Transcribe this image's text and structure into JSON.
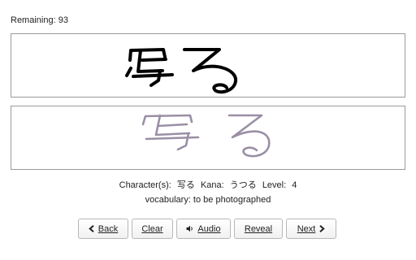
{
  "status": {
    "remaining": "Remaining: 93"
  },
  "character_info": {
    "chars_label": "Character(s):",
    "chars_value": "写る",
    "kana_label": "Kana:",
    "kana_value": "うつる",
    "level_label": "Level:",
    "level_value": "4"
  },
  "vocabulary": {
    "text": "vocabulary: to be photographed"
  },
  "toolbar": {
    "back_label": "Back",
    "clear_label": "Clear",
    "audio_label": "Audio",
    "reveal_label": "Reveal",
    "next_label": "Next"
  },
  "icons": {
    "back": "chevron-left-icon",
    "audio": "speaker-icon",
    "next": "chevron-right-icon"
  },
  "colors": {
    "user_stroke": "#000000",
    "reference_stroke": "#9a8fa5",
    "panel_border": "#9a9a9a"
  }
}
